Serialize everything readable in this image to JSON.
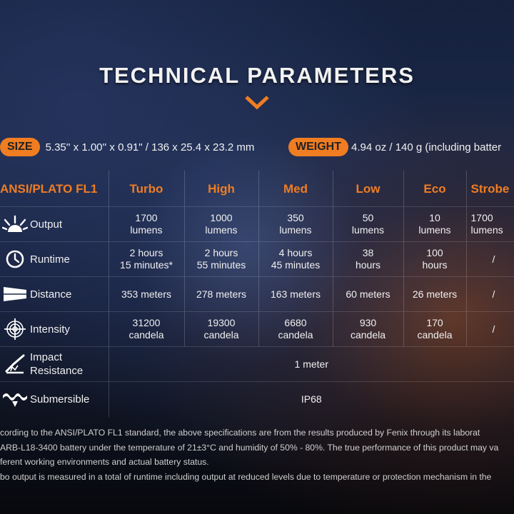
{
  "title": "TECHNICAL PARAMETERS",
  "size": {
    "label": "SIZE",
    "value": "5.35'' x 1.00'' x 0.91\" / 136 x 25.4 x 23.2 mm"
  },
  "weight": {
    "label": "WEIGHT",
    "value": "4.94 oz / 140 g (including batter"
  },
  "table": {
    "header": [
      "ANSI/PLATO FL1",
      "Turbo",
      "High",
      "Med",
      "Low",
      "Eco",
      "Strobe"
    ],
    "rows": {
      "output": {
        "label": "Output",
        "icon": "light-burst-icon",
        "cells": [
          [
            "1700",
            "lumens"
          ],
          [
            "1000",
            "lumens"
          ],
          [
            "350",
            "lumens"
          ],
          [
            "50",
            "lumens"
          ],
          [
            "10",
            "lumens"
          ],
          [
            "1700",
            "lumens"
          ]
        ]
      },
      "runtime": {
        "label": "Runtime",
        "icon": "clock-icon",
        "cells": [
          [
            "2 hours",
            "15 minutes*"
          ],
          [
            "2 hours",
            "55 minutes"
          ],
          [
            "4 hours",
            "45 minutes"
          ],
          [
            "38",
            "hours"
          ],
          [
            "100",
            "hours"
          ],
          [
            "/",
            ""
          ]
        ]
      },
      "distance": {
        "label": "Distance",
        "icon": "beam-distance-icon",
        "cells": [
          "353 meters",
          "278 meters",
          "163 meters",
          "60 meters",
          "26 meters",
          "/"
        ]
      },
      "intensity": {
        "label": "Intensity",
        "icon": "target-icon",
        "cells": [
          [
            "31200",
            "candela"
          ],
          [
            "19300",
            "candela"
          ],
          [
            "6680",
            "candela"
          ],
          [
            "930",
            "candela"
          ],
          [
            "170",
            "candela"
          ],
          [
            "/",
            ""
          ]
        ]
      },
      "impact": {
        "label_line1": "Impact",
        "label_line2": "Resistance",
        "icon": "impact-icon",
        "value": "1 meter"
      },
      "submersible": {
        "label": "Submersible",
        "icon": "water-wave-icon",
        "value": "IP68"
      }
    }
  },
  "notes": [
    "cording to the ANSI/PLATO FL1 standard, the above specifications are from the results produced by Fenix through its laborat",
    "ARB-L18-3400 battery under the temperature of 21±3°C and humidity of 50% - 80%. The true performance of this product may va",
    "ferent working environments and actual battery status.",
    "bo output is measured in a total of runtime including output at reduced levels due to temperature or protection mechanism in the"
  ],
  "colors": {
    "accent": "#f07d22",
    "text": "#f0f0f0"
  }
}
